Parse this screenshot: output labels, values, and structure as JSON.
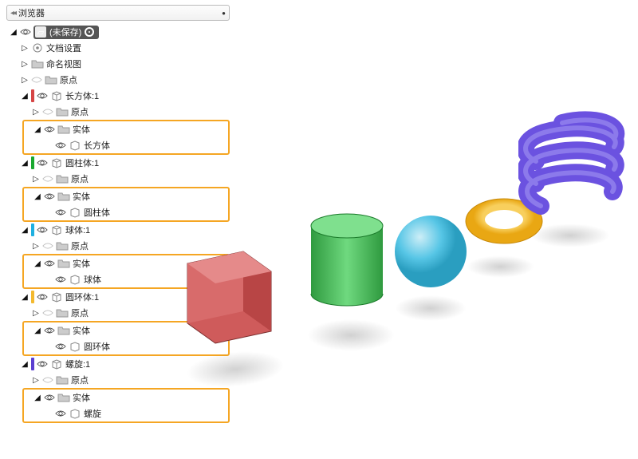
{
  "browser": {
    "header_title": "浏览器",
    "root_label": "(未保存)",
    "items": {
      "docset": "文档设置",
      "views": "命名视图",
      "origin": "原点",
      "box_comp": "长方体:1",
      "bodies": "实体",
      "box_body": "长方体",
      "cyl_comp": "圆柱体:1",
      "cyl_body": "圆柱体",
      "sph_comp": "球体:1",
      "sph_body": "球体",
      "tor_comp": "圆环体:1",
      "tor_body": "圆环体",
      "coil_comp": "螺旋:1",
      "coil_body": "螺旋"
    }
  },
  "colors": {
    "box": "#d64545",
    "cyl": "#19a82f",
    "sph": "#1fb0e0",
    "tor": "#f3b92e",
    "coil": "#5b3fd1",
    "highlight": "#f5a623"
  }
}
